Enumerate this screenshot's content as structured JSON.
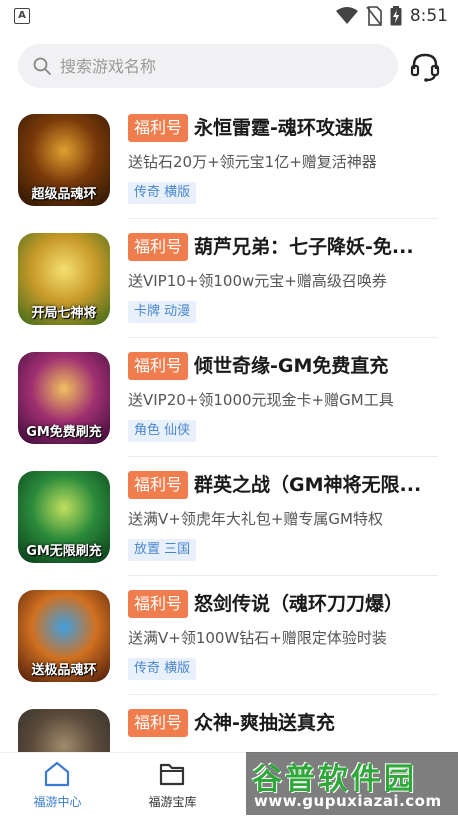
{
  "status_bar": {
    "notification_letter": "A",
    "time": "8:51",
    "icons": [
      "wifi-icon",
      "no-sim-icon",
      "battery-charging-icon"
    ]
  },
  "search": {
    "placeholder": "搜索游戏名称",
    "value": "",
    "search_icon": "search-icon",
    "support_icon": "headset-icon"
  },
  "games": [
    {
      "tag": "福利号",
      "title": "永恒雷霆-魂环攻速版",
      "desc": "送钻石20万+领元宝1亿+赠复活神器",
      "category": "传奇 横版",
      "thumb_caption": "超级品魂环",
      "thumb_colors": [
        "#2a1404",
        "#7a3a0a",
        "#e0a030"
      ]
    },
    {
      "tag": "福利号",
      "title": "葫芦兄弟：七子降妖-免...",
      "desc": "送VIP10+领100w元宝+赠高级召唤券",
      "category": "卡牌 动漫",
      "thumb_caption": "开局七神将",
      "thumb_colors": [
        "#3a6a1a",
        "#c89a2a",
        "#f4e070"
      ]
    },
    {
      "tag": "福利号",
      "title": "倾世奇缘-GM免费直充",
      "desc": "送VIP20+领1000元现金卡+赠GM工具",
      "category": "角色 仙侠",
      "thumb_caption": "GM免费刷充",
      "thumb_colors": [
        "#3a0a3a",
        "#a03070",
        "#f0c060"
      ]
    },
    {
      "tag": "福利号",
      "title": "群英之战（GM神将无限...",
      "desc": "送满V+领虎年大礼包+赠专属GM特权",
      "category": "放置 三国",
      "thumb_caption": "GM无限刷充",
      "thumb_colors": [
        "#0a3a1a",
        "#2a8a3a",
        "#c0e060"
      ]
    },
    {
      "tag": "福利号",
      "title": "怒剑传说（魂环刀刀爆）",
      "desc": "送满V+领100W钻石+赠限定体验时装",
      "category": "传奇 横版",
      "thumb_caption": "送极品魂环",
      "thumb_colors": [
        "#4a1a0a",
        "#d07020",
        "#40a0e0"
      ]
    },
    {
      "tag": "福利号",
      "title": "众神-爽抽送真充",
      "desc": "",
      "category": "",
      "thumb_caption": "",
      "thumb_colors": [
        "#2a2a2a",
        "#5a4a3a",
        "#a08a6a"
      ]
    }
  ],
  "tabs": [
    {
      "label": "福游中心",
      "icon": "home-icon",
      "active": true
    },
    {
      "label": "福游宝库",
      "icon": "folder-icon",
      "active": false
    }
  ],
  "watermark": {
    "title": "谷普软件园",
    "url": "www.gupuxiazai.com"
  },
  "colors": {
    "tag_bg": "#f07d4e",
    "category_text": "#4a86d0",
    "tab_active": "#3a7bd5",
    "tab_inactive": "#333333"
  }
}
